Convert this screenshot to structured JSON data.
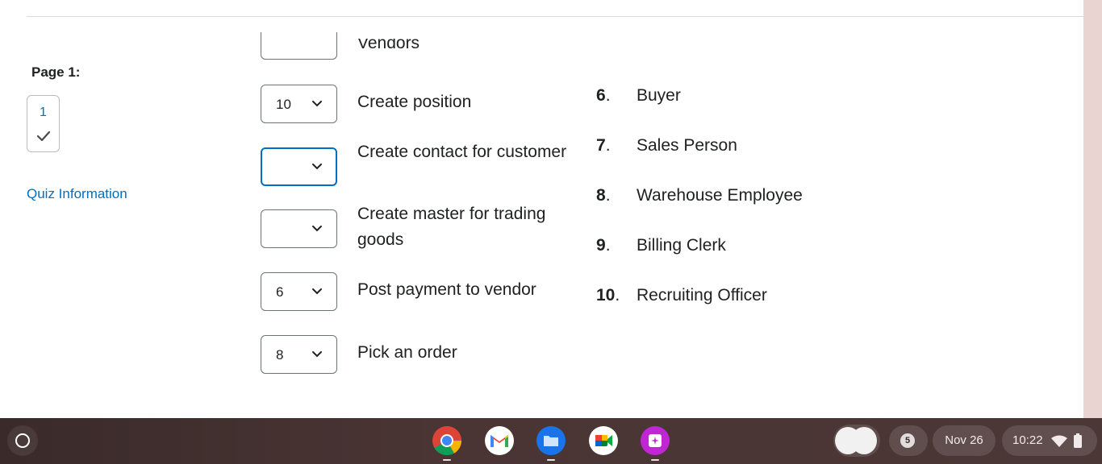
{
  "nav": {
    "page_label": "Page 1:",
    "page_tile_number": "1",
    "quiz_info_link": "Quiz Information"
  },
  "matching": {
    "partial_statement": "Vendors",
    "rows": [
      {
        "selected": "10",
        "statement": "Create position"
      },
      {
        "selected": "",
        "statement": "Create contact for customer"
      },
      {
        "selected": "",
        "statement": "Create master for trading goods"
      },
      {
        "selected": "6",
        "statement": "Post payment to vendor"
      },
      {
        "selected": "8",
        "statement": "Pick an order"
      }
    ],
    "answers": [
      {
        "num": "6",
        "label": "Buyer"
      },
      {
        "num": "7",
        "label": "Sales Person"
      },
      {
        "num": "8",
        "label": "Warehouse Employee"
      },
      {
        "num": "9",
        "label": "Billing Clerk"
      },
      {
        "num": "10",
        "label": "Recruiting Officer"
      }
    ]
  },
  "taskbar": {
    "apps": [
      "chrome-icon",
      "gmail-icon",
      "files-icon",
      "google-meet-icon",
      "screencast-icon"
    ],
    "notification_count": "5",
    "date": "Nov 26",
    "time": "10:22"
  },
  "colors": {
    "link": "#006fbf",
    "text": "#202122",
    "focus_border": "#006fbf",
    "taskbar": "#4a3534"
  }
}
